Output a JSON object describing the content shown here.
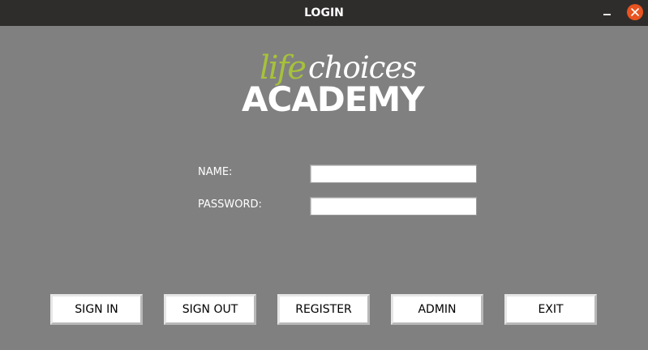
{
  "window": {
    "title": "LOGIN",
    "controls": {
      "minimize_icon": "minimize-icon",
      "close_icon": "close-icon"
    }
  },
  "logo": {
    "life": "life",
    "choices": "choices",
    "academy": "ACADEMY",
    "colors": {
      "life": "#a6c23a",
      "choices": "#ffffff",
      "academy": "#ffffff"
    }
  },
  "form": {
    "name_label": "NAME:",
    "name_value": "",
    "password_label": "PASSWORD:",
    "password_value": ""
  },
  "buttons": {
    "sign_in": "SIGN IN",
    "sign_out": "SIGN OUT",
    "register": "REGISTER",
    "admin": "ADMIN",
    "exit": "EXIT"
  },
  "colors": {
    "background": "#808080",
    "titlebar": "#2f2d2c",
    "close_button": "#e95420"
  }
}
